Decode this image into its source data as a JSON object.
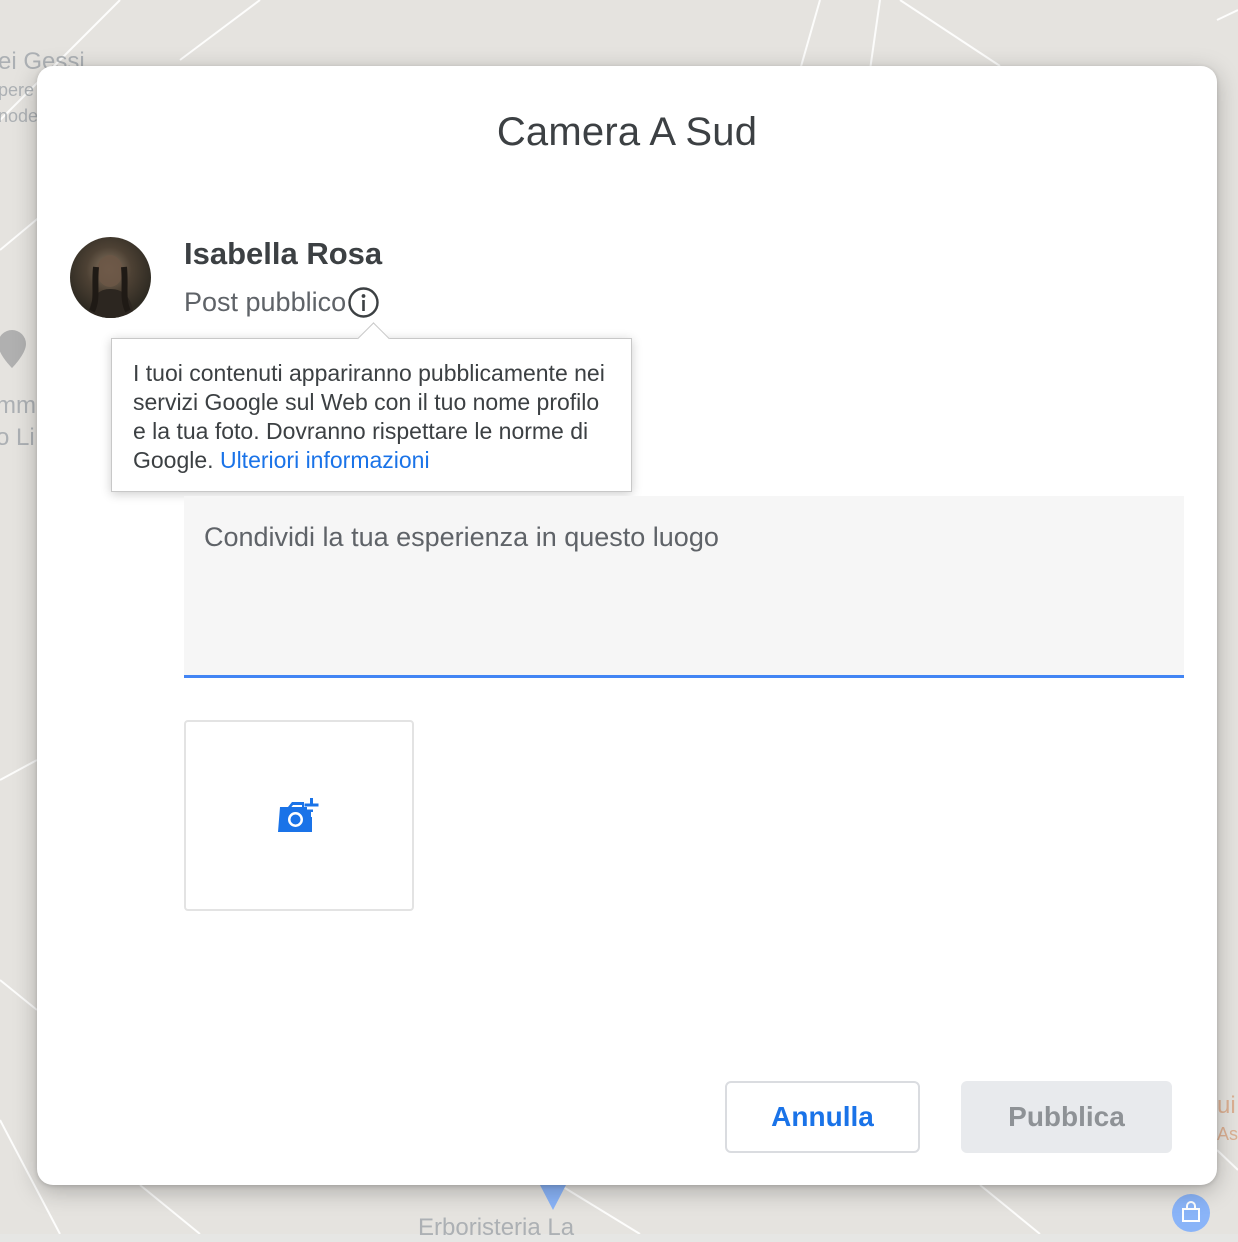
{
  "map": {
    "labels": {
      "top_left_1": "ei Gessi",
      "top_left_2": "pere",
      "top_left_3": "node",
      "left_1": "mm",
      "left_2": "o Li",
      "bottom_center": "Erboristeria La",
      "right_1": "ui",
      "right_2": "As"
    }
  },
  "dialog": {
    "title": "Camera A Sud",
    "user": {
      "name": "Isabella Rosa",
      "post_type": "Post pubblico"
    },
    "tooltip": {
      "text": "I tuoi contenuti appariranno pubblicamente nei servizi Google sul Web con il tuo nome profilo e la tua foto. Dovranno rispettare le norme di Google. ",
      "link": "Ulteriori informazioni"
    },
    "review": {
      "placeholder": "Condividi la tua esperienza in questo luogo",
      "value": ""
    },
    "buttons": {
      "cancel": "Annulla",
      "publish": "Pubblica"
    },
    "icons": {
      "info": "info-icon",
      "add_photo": "add-photo-camera-icon"
    },
    "colors": {
      "accent": "#1a73e8",
      "input_underline": "#4285f4",
      "disabled_bg": "#e8eaed",
      "disabled_text": "#8e9296"
    }
  }
}
